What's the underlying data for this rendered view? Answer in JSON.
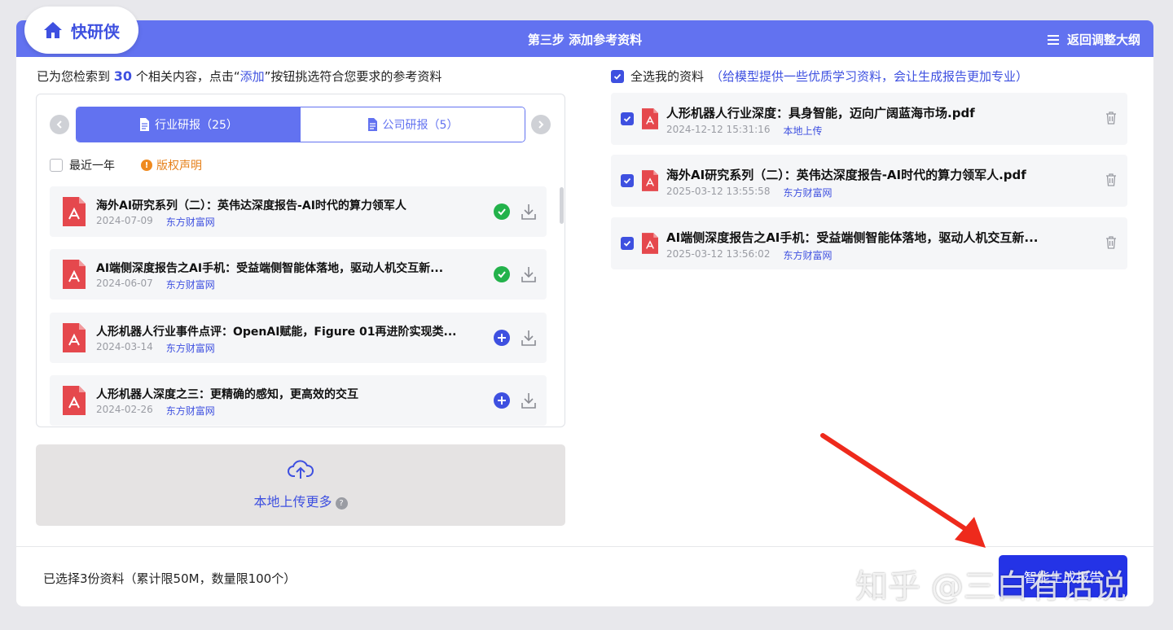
{
  "logo": {
    "label": "快研侠",
    "icon": "home-icon"
  },
  "header": {
    "step_title": "第三步 添加参考资料",
    "back_label": "返回调整大纲",
    "back_icon": "menu-icon"
  },
  "search_summary": {
    "prefix": "已为您检索到",
    "count": "30",
    "middle": "个相关内容，点击“",
    "add_word": "添加",
    "suffix": "”按钮挑选符合您要求的参考资料"
  },
  "tabs": [
    {
      "label": "行业研报（25）",
      "active": true
    },
    {
      "label": "公司研报（5）",
      "active": false
    }
  ],
  "filter": {
    "recent_year_label": "最近一年",
    "recent_year_checked": false,
    "copyright_label": "版权声明"
  },
  "results": [
    {
      "title": "海外AI研究系列（二）：英伟达深度报告-AI时代的算力领军人",
      "date": "2024-07-09",
      "source": "东方财富网",
      "status": "added"
    },
    {
      "title": "AI端侧深度报告之AI手机：受益端侧智能体落地，驱动人机交互新...",
      "date": "2024-06-07",
      "source": "东方财富网",
      "status": "added"
    },
    {
      "title": "人形机器人行业事件点评：OpenAI赋能，Figure 01再进阶实现类...",
      "date": "2024-03-14",
      "source": "东方财富网",
      "status": "add"
    },
    {
      "title": "人形机器人深度之三：更精确的感知，更高效的交互",
      "date": "2024-02-26",
      "source": "东方财富网",
      "status": "add"
    }
  ],
  "upload": {
    "label": "本地上传更多",
    "help": "?"
  },
  "my_materials": {
    "select_all_label": "全选我的资料",
    "hint": "（给模型提供一些优质学习资料，会让生成报告更加专业）",
    "select_all_checked": true,
    "items": [
      {
        "title": "人形机器人行业深度：具身智能，迈向广阔蓝海市场.pdf",
        "datetime": "2024-12-12 15:31:16",
        "source": "本地上传",
        "checked": true
      },
      {
        "title": "海外AI研究系列（二）：英伟达深度报告-AI时代的算力领军人.pdf",
        "datetime": "2025-03-12 13:55:58",
        "source": "东方财富网",
        "checked": true
      },
      {
        "title": "AI端侧深度报告之AI手机：受益端侧智能体落地，驱动人机交互新...",
        "datetime": "2025-03-12 13:56:02",
        "source": "东方财富网",
        "checked": true
      }
    ]
  },
  "footer": {
    "selection_text": "已选择3份资料（累计限50M，数量限100个）",
    "generate_label": "智能生成报告"
  },
  "watermark": "知乎 @三白有话说",
  "colors": {
    "accent": "#6272f0",
    "primary_text_blue": "#3e50e0",
    "button": "#2433e6",
    "pdf_red": "#e5484d",
    "success": "#23b24b",
    "warning": "#e6801a",
    "arrow": "#ee2a1c"
  }
}
